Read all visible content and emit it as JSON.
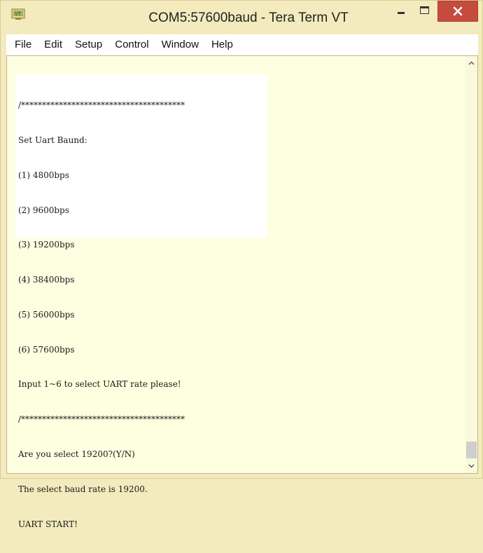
{
  "window": {
    "title": "COM5:57600baud - Tera Term VT",
    "icon": "tera-term-icon",
    "controls": {
      "minimize_icon": "minimize-icon",
      "maximize_icon": "maximize-icon",
      "close_icon": "close-icon"
    },
    "colors": {
      "frame": "#f3ebbd",
      "close_button": "#c64b3f",
      "terminal_background": "#fefee0"
    }
  },
  "menu": {
    "items": [
      "File",
      "Edit",
      "Setup",
      "Control",
      "Window",
      "Help"
    ]
  },
  "terminal": {
    "lines": [
      "/***************************************",
      "Set Uart Baund:",
      "(1) 4800bps",
      "(2) 9600bps",
      "(3) 19200bps",
      "(4) 38400bps",
      "(5) 56000bps",
      "(6) 57600bps",
      "Input 1~6 to select UART rate please!",
      "/***************************************",
      "Are you select 19200?(Y/N)",
      "The select baud rate is 19200.",
      "UART START!"
    ]
  },
  "scrollbar": {
    "up_icon": "chevron-up-icon",
    "down_icon": "chevron-down-icon",
    "position": 1.0
  }
}
